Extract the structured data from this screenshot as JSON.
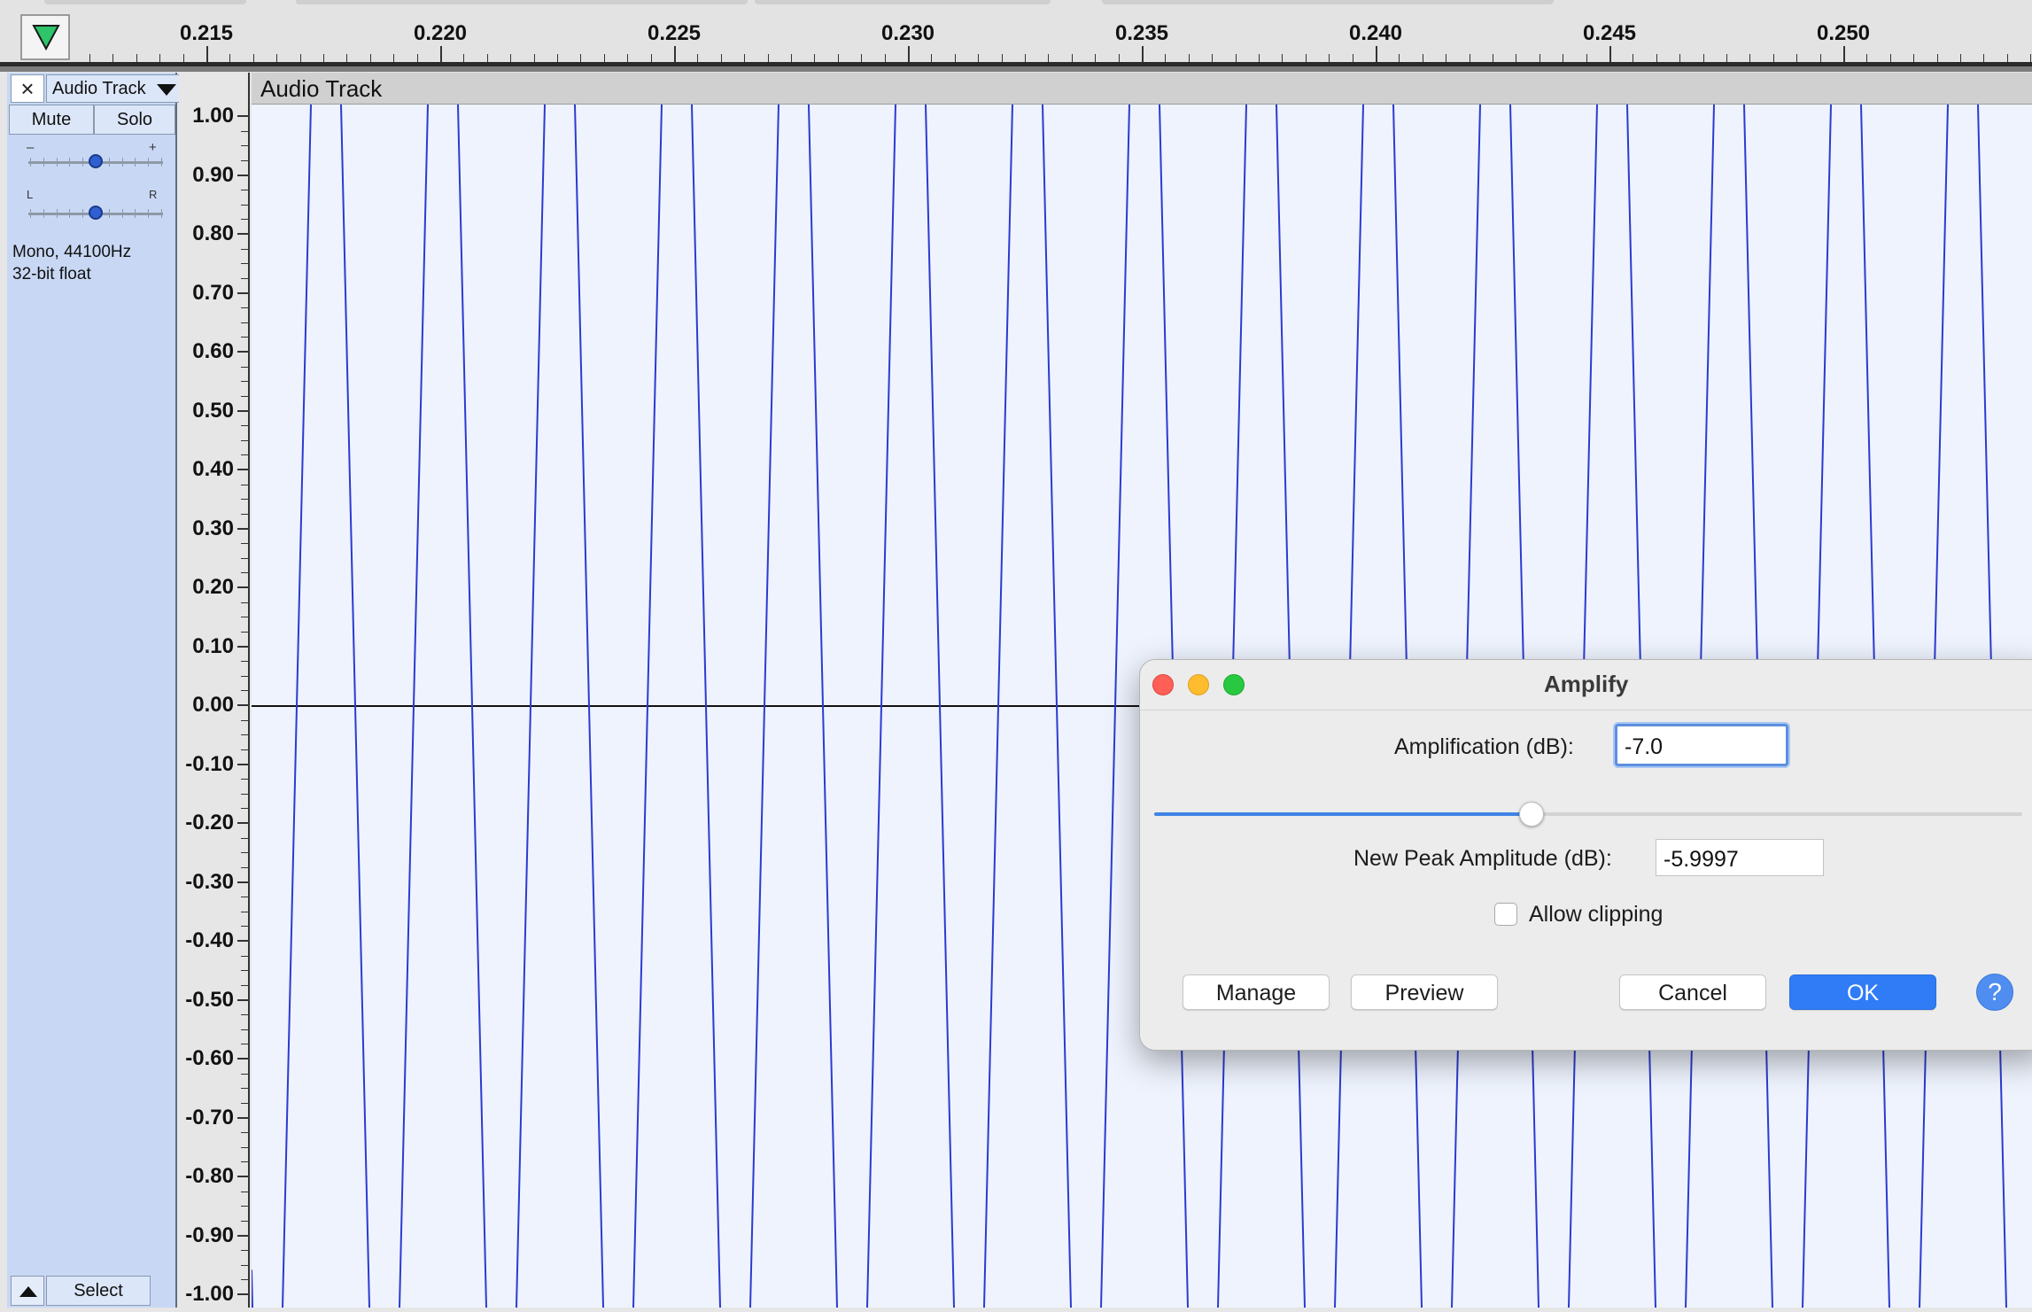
{
  "timeline": {
    "ticks": [
      "0.215",
      "0.220",
      "0.225",
      "0.230",
      "0.235",
      "0.240",
      "0.245",
      "0.250"
    ],
    "play_icon": "play-triangle-icon"
  },
  "track_panel": {
    "close_label": "×",
    "name": "Audio Track",
    "mute_label": "Mute",
    "solo_label": "Solo",
    "gain_minus": "–",
    "gain_plus": "+",
    "pan_left": "L",
    "pan_right": "R",
    "gain_level": 0.5,
    "pan_level": 0.5,
    "info_line1": "Mono, 44100Hz",
    "info_line2": "32-bit float",
    "select_label": "Select"
  },
  "amplitude_ruler": {
    "labels": [
      "1.00",
      "0.90",
      "0.80",
      "0.70",
      "0.60",
      "0.50",
      "0.40",
      "0.30",
      "0.20",
      "0.10",
      "0.00",
      "-0.10",
      "-0.20",
      "-0.30",
      "-0.40",
      "-0.50",
      "-0.60",
      "-0.70",
      "-0.80",
      "-0.90",
      "-1.00"
    ]
  },
  "waveform": {
    "title": "Audio Track",
    "color": "#2b3bd0",
    "background": "#eef3fd"
  },
  "dialog": {
    "title": "Amplify",
    "amplification_label": "Amplification (dB):",
    "amplification_value": "-7.0",
    "slider_level": 0.435,
    "peak_label": "New Peak Amplitude (dB):",
    "peak_value": "-5.9997",
    "allow_clipping_label": "Allow clipping",
    "allow_clipping_checked": false,
    "manage_label": "Manage",
    "preview_label": "Preview",
    "cancel_label": "Cancel",
    "ok_label": "OK",
    "help_label": "?",
    "colors": {
      "close": "#fe5f57",
      "minimize": "#febc2e",
      "zoom": "#28c840",
      "accent": "#2f7cf6"
    }
  }
}
